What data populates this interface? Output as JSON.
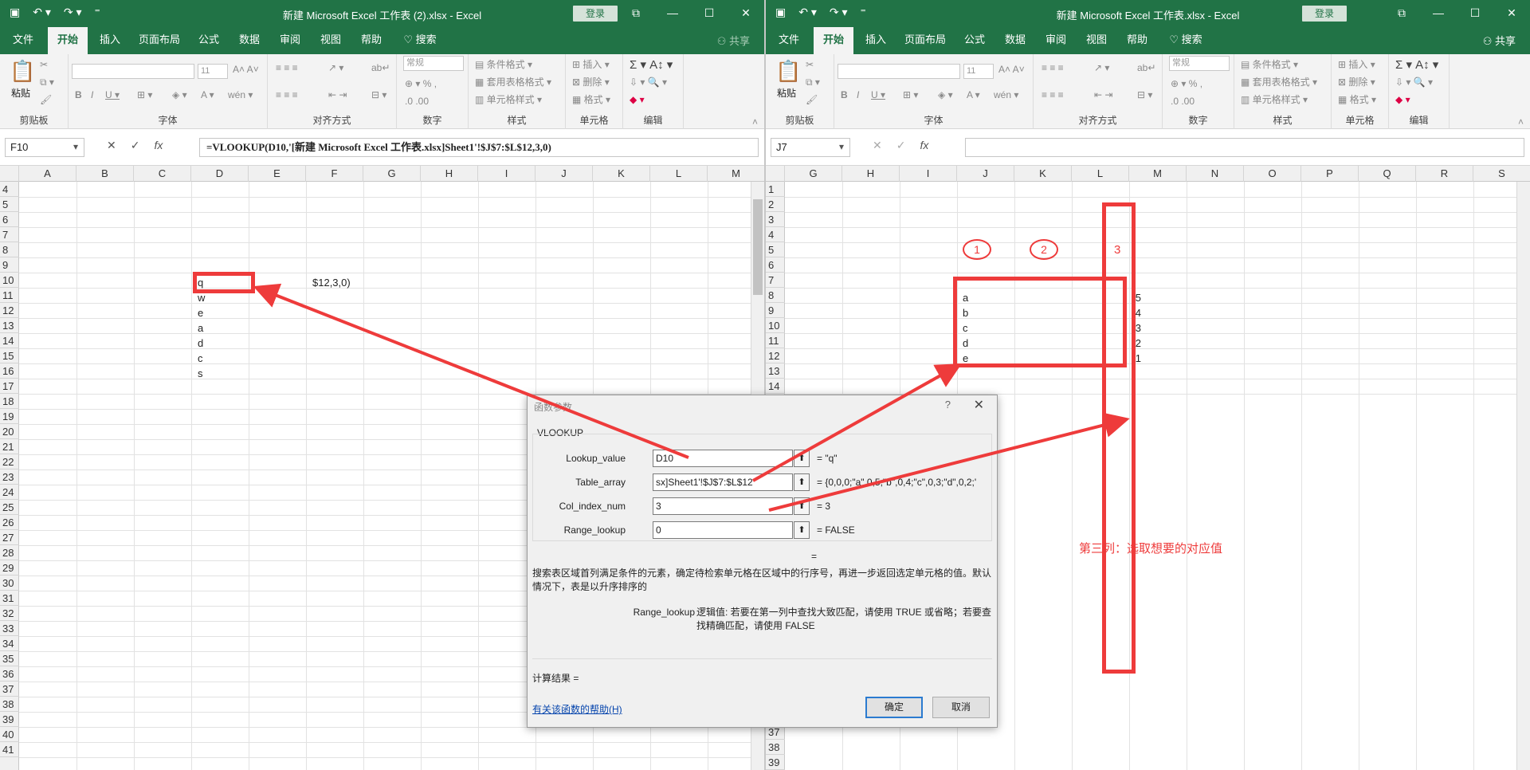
{
  "left_window": {
    "title": "新建 Microsoft Excel 工作表 (2).xlsx  -  Excel",
    "login": "登录",
    "tabs": [
      "文件",
      "开始",
      "插入",
      "页面布局",
      "公式",
      "数据",
      "审阅",
      "视图",
      "帮助",
      "搜索"
    ],
    "share": "共享",
    "ribbon_groups": [
      "剪贴板",
      "字体",
      "对齐方式",
      "数字",
      "样式",
      "单元格",
      "编辑"
    ],
    "paste_label": "粘贴",
    "font_size": "11",
    "number_format": "常规",
    "conditional_format": "条件格式",
    "table_format": "套用表格格式",
    "cell_style": "单元格样式",
    "insert": "插入",
    "delete": "删除",
    "format": "格式",
    "name_box": "F10",
    "formula": "=VLOOKUP(D10,'[新建 Microsoft Excel 工作表.xlsx]Sheet1'!$J$7:$L$12,3,0)",
    "columns": [
      "A",
      "B",
      "C",
      "D",
      "E",
      "F",
      "G",
      "H",
      "I",
      "J",
      "K",
      "L",
      "M"
    ],
    "rows": [
      "4",
      "5",
      "6",
      "7",
      "8",
      "9",
      "10",
      "11",
      "12",
      "13",
      "14",
      "15",
      "16",
      "17",
      "18",
      "19",
      "20",
      "21",
      "22",
      "23",
      "24",
      "25",
      "26",
      "27",
      "28",
      "29",
      "30",
      "31",
      "32",
      "33",
      "34",
      "35",
      "36",
      "37",
      "38",
      "39",
      "40",
      "41"
    ],
    "cells": {
      "d10": "q",
      "d11": "w",
      "d12": "e",
      "d13": "a",
      "d14": "d",
      "d15": "c",
      "d16": "s",
      "f10": "$12,3,0)"
    }
  },
  "right_window": {
    "title": "新建 Microsoft Excel 工作表.xlsx  -  Excel",
    "login": "登录",
    "tabs": [
      "文件",
      "开始",
      "插入",
      "页面布局",
      "公式",
      "数据",
      "审阅",
      "视图",
      "帮助",
      "搜索"
    ],
    "share": "共享",
    "name_box": "J7",
    "formula": "",
    "columns": [
      "G",
      "H",
      "I",
      "J",
      "K",
      "L",
      "M",
      "N",
      "O",
      "P",
      "Q",
      "R",
      "S"
    ],
    "rows": [
      "1",
      "2",
      "3",
      "4",
      "5",
      "6",
      "7",
      "8",
      "9",
      "10",
      "11",
      "12",
      "13",
      "14"
    ],
    "bottom_rows": [
      "37",
      "38",
      "39"
    ],
    "table": [
      [
        "a",
        "5"
      ],
      [
        "b",
        "4"
      ],
      [
        "c",
        "3"
      ],
      [
        "d",
        "2"
      ],
      [
        "e",
        "1"
      ]
    ],
    "annotations": {
      "circle1": "1",
      "circle2": "2",
      "label3": "3",
      "note": "第三列：选取想要的对应值"
    }
  },
  "dialog": {
    "title": "函数参数",
    "help_q": "?",
    "close": "✕",
    "function": "VLOOKUP",
    "args": [
      {
        "label": "Lookup_value",
        "value": "D10",
        "result": "=  \"q\""
      },
      {
        "label": "Table_array",
        "value": "sx]Sheet1'!$J$7:$L$12",
        "result": "=  {0,0,0;\"a\",0,5;\"b\",0,4;\"c\",0,3;\"d\",0,2;'"
      },
      {
        "label": "Col_index_num",
        "value": "3",
        "result": "=  3"
      },
      {
        "label": "Range_lookup",
        "value": "0",
        "result": "=  FALSE"
      }
    ],
    "eq": "=",
    "description": "搜索表区域首列满足条件的元素，确定待检索单元格在区域中的行序号，再进一步返回选定单元格的值。默认情况下，表是以升序排序的",
    "param_name": "Range_lookup",
    "param_desc": "逻辑值: 若要在第一列中查找大致匹配，请使用 TRUE 或省略；若要查找精确匹配，请使用 FALSE",
    "calc_result": "计算结果 =",
    "help_link": "有关该函数的帮助(H)",
    "ok": "确定",
    "cancel": "取消"
  },
  "colors": {
    "excel_green": "#217346",
    "annotation_red": "#ee3b3b"
  }
}
